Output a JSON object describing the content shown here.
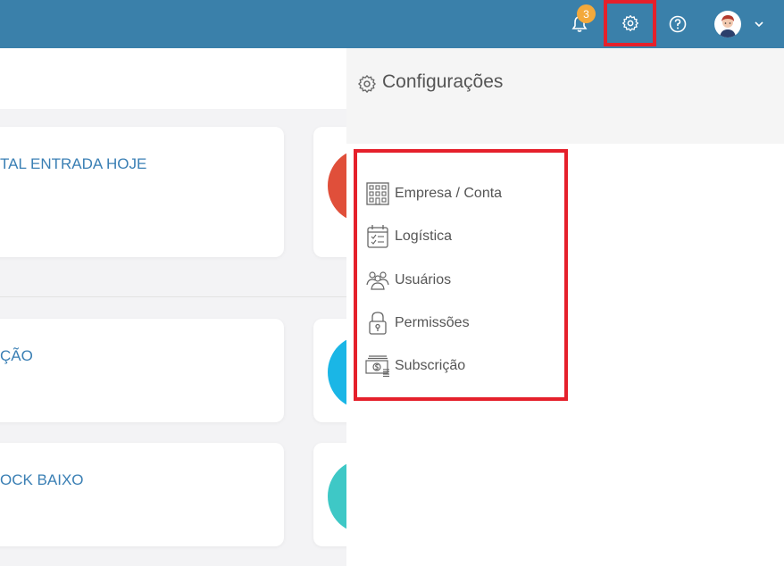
{
  "header": {
    "notification_count": "3",
    "icons": [
      "bell-icon",
      "gear-icon",
      "help-icon",
      "avatar",
      "chevron-down-icon"
    ]
  },
  "dashboard": {
    "cards": [
      {
        "title": "TAL ENTRADA HOJE",
        "accent": "#e04f3a"
      },
      {
        "title": "ÇÃO",
        "accent": "#1ab6e6"
      },
      {
        "title": "OCK BAIXO",
        "accent": "#3ec8c6"
      }
    ]
  },
  "settings_panel": {
    "title": "Configurações",
    "items": [
      {
        "label": "Empresa / Conta",
        "icon": "building-icon"
      },
      {
        "label": "Logística",
        "icon": "calendar-check-icon"
      },
      {
        "label": "Usuários",
        "icon": "users-icon"
      },
      {
        "label": "Permissões",
        "icon": "lock-icon"
      },
      {
        "label": "Subscrição",
        "icon": "money-icon"
      }
    ]
  },
  "colors": {
    "header": "#3a80aa",
    "badge": "#f3a93b",
    "highlight": "#e5202b",
    "card_title": "#3a7fb4"
  }
}
